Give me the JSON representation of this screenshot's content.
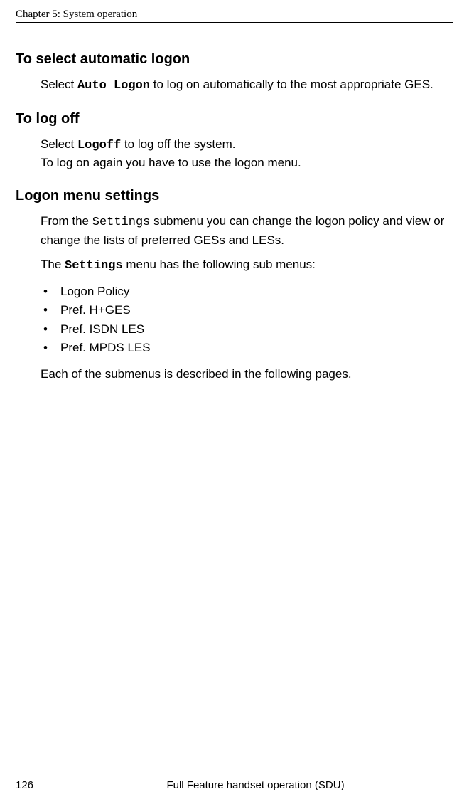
{
  "header": {
    "running": "Chapter 5:  System operation"
  },
  "sections": {
    "autologon": {
      "heading": "To select automatic logon",
      "text_prefix": " Select ",
      "code": "Auto Logon",
      "text_suffix": " to log on automatically to the most appropriate GES."
    },
    "logoff": {
      "heading": "To log off",
      "line1_prefix": "Select ",
      "line1_code": "Logoff",
      "line1_suffix": " to log off the system.",
      "line2": "To log on again you have to use the logon menu."
    },
    "settings": {
      "heading": "Logon menu settings",
      "p1_prefix": "From the ",
      "p1_code": "Settings",
      "p1_suffix": " submenu you can change the logon policy and view or change the lists of preferred GESs and LESs.",
      "p2_prefix": "The ",
      "p2_code": "Settings",
      "p2_suffix": " menu has the following sub menus:",
      "bullets": [
        "Logon Policy",
        "Pref. H+GES",
        "Pref. ISDN LES",
        "Pref. MPDS LES"
      ],
      "p3": "Each of the submenus is described in the following pages."
    }
  },
  "footer": {
    "page": "126",
    "title": "Full Feature handset operation (SDU)"
  }
}
